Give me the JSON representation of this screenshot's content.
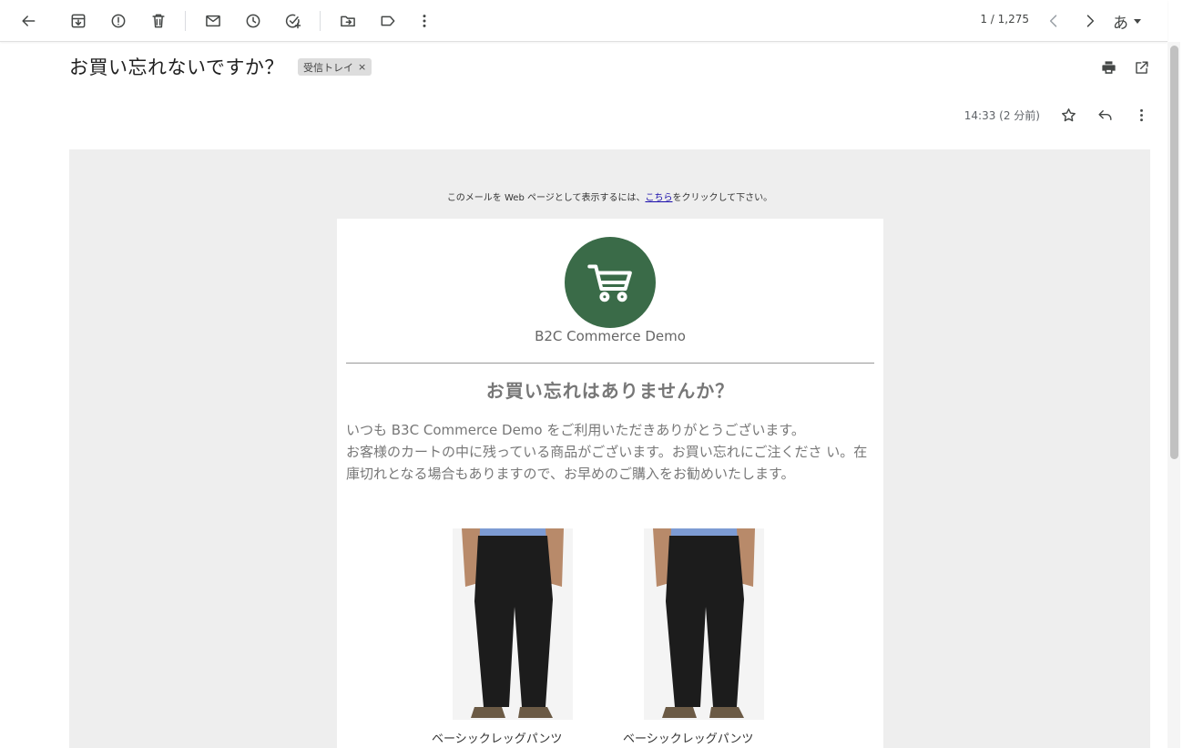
{
  "toolbar": {
    "pager": "1 / 1,275",
    "lang_label": "あ"
  },
  "message": {
    "subject": "お買い忘れないですか？",
    "label": "受信トレイ",
    "label_remove": "×",
    "timestamp": "14:33 (2 分前)"
  },
  "email": {
    "webview_prefix": "このメールを Web ページとして表示するには、",
    "webview_link": "こちら",
    "webview_suffix": "をクリックして下さい。",
    "brand": "B2C Commerce Demo",
    "headline": "お買い忘れはありませんか？",
    "body_line1": "いつも B3C Commerce Demo をご利用いただきありがとうございます。",
    "body_line2": "お客様のカートの中に残っている商品がございます。お買い忘れにご注くださ い。在庫切れとなる場合もありますので、お早めのご購入をお勧めいたします。",
    "products": [
      {
        "name": "ベーシックレッグパンツ"
      },
      {
        "name": "ベーシックレッグパンツ"
      }
    ]
  },
  "colors": {
    "brand_green": "#3a6b48",
    "mail_background": "#eeeeee"
  }
}
